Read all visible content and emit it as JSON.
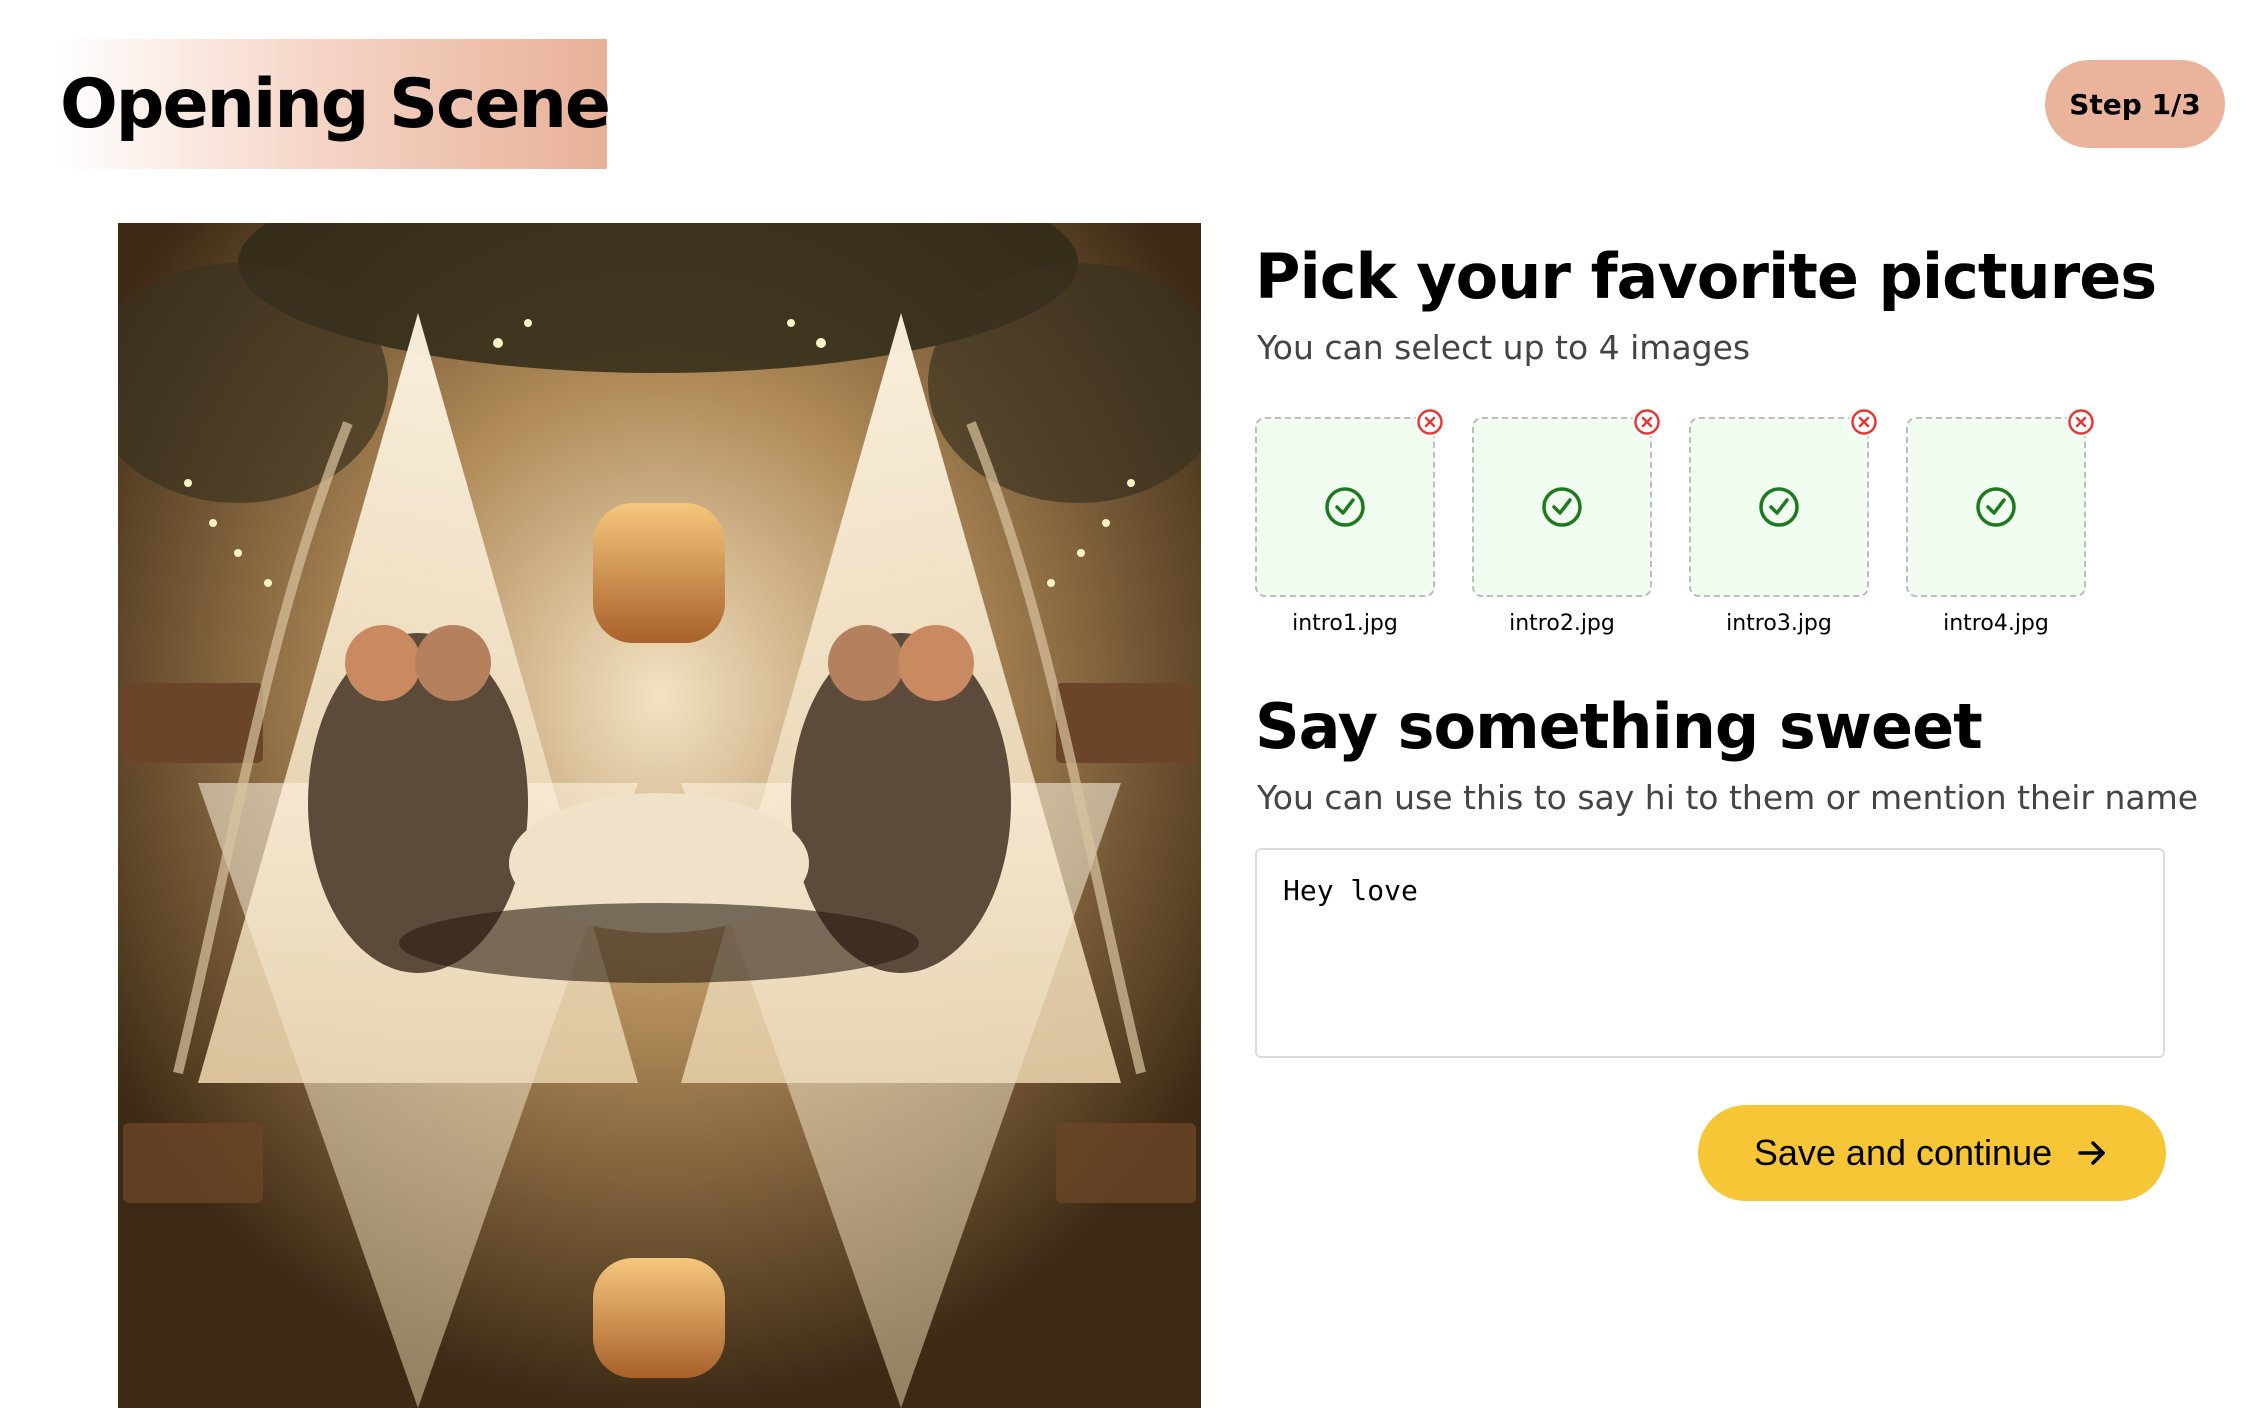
{
  "header": {
    "title": "Opening Scene",
    "step": "Step 1/3"
  },
  "colors": {
    "title_highlight": "#e9b39c",
    "step_badge": "#e9b39c",
    "thumb_background": "#f0fdf0",
    "check_green": "#1f7a1f",
    "remove_red": "#e53935",
    "primary_button": "#f6c637"
  },
  "photo": {
    "description_icon": "couple-teepee-photo"
  },
  "pictures": {
    "title": "Pick your favorite pictures",
    "subtitle": "You can select up to 4 images",
    "items": [
      {
        "name": "intro1.jpg",
        "status_icon": "check-circle-icon",
        "remove_icon": "close-circle-icon"
      },
      {
        "name": "intro2.jpg",
        "status_icon": "check-circle-icon",
        "remove_icon": "close-circle-icon"
      },
      {
        "name": "intro3.jpg",
        "status_icon": "check-circle-icon",
        "remove_icon": "close-circle-icon"
      },
      {
        "name": "intro4.jpg",
        "status_icon": "check-circle-icon",
        "remove_icon": "close-circle-icon"
      }
    ]
  },
  "message": {
    "title": "Say something sweet",
    "subtitle": "You can use this to say hi to them or mention their name",
    "value": "Hey love"
  },
  "actions": {
    "save_label": "Save and continue",
    "save_icon": "arrow-right-icon"
  }
}
